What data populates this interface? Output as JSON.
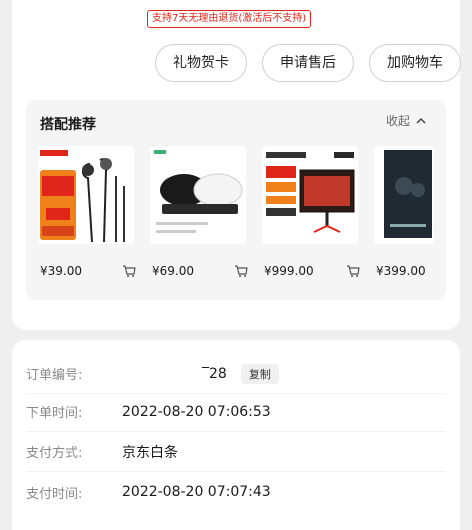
{
  "promise": "支持7天无理由退货(激活后不支持)",
  "actions": {
    "gift_card": "礼物贺卡",
    "after_sale": "申请售后",
    "add_cart": "加购物车"
  },
  "recommend": {
    "title": "搭配推荐",
    "collapse": "收起",
    "products": [
      {
        "price": "¥39.00",
        "icon": "earphones-image"
      },
      {
        "price": "¥69.00",
        "icon": "controller-charger-image"
      },
      {
        "price": "¥999.00",
        "icon": "gaming-monitor-image"
      },
      {
        "price": "¥399.00",
        "icon": "earbuds-box-image"
      }
    ]
  },
  "order": {
    "rows": [
      {
        "label": "订单编号:",
        "value": "‾28",
        "copy": "复制"
      },
      {
        "label": "下单时间:",
        "value": "2022-08-20 07:06:53"
      },
      {
        "label": "支付方式:",
        "value": "京东白条"
      },
      {
        "label": "支付时间:",
        "value": "2022-08-20 07:07:43"
      }
    ]
  },
  "colors": {
    "accent_red": "#e0251b",
    "background": "#efefef"
  }
}
